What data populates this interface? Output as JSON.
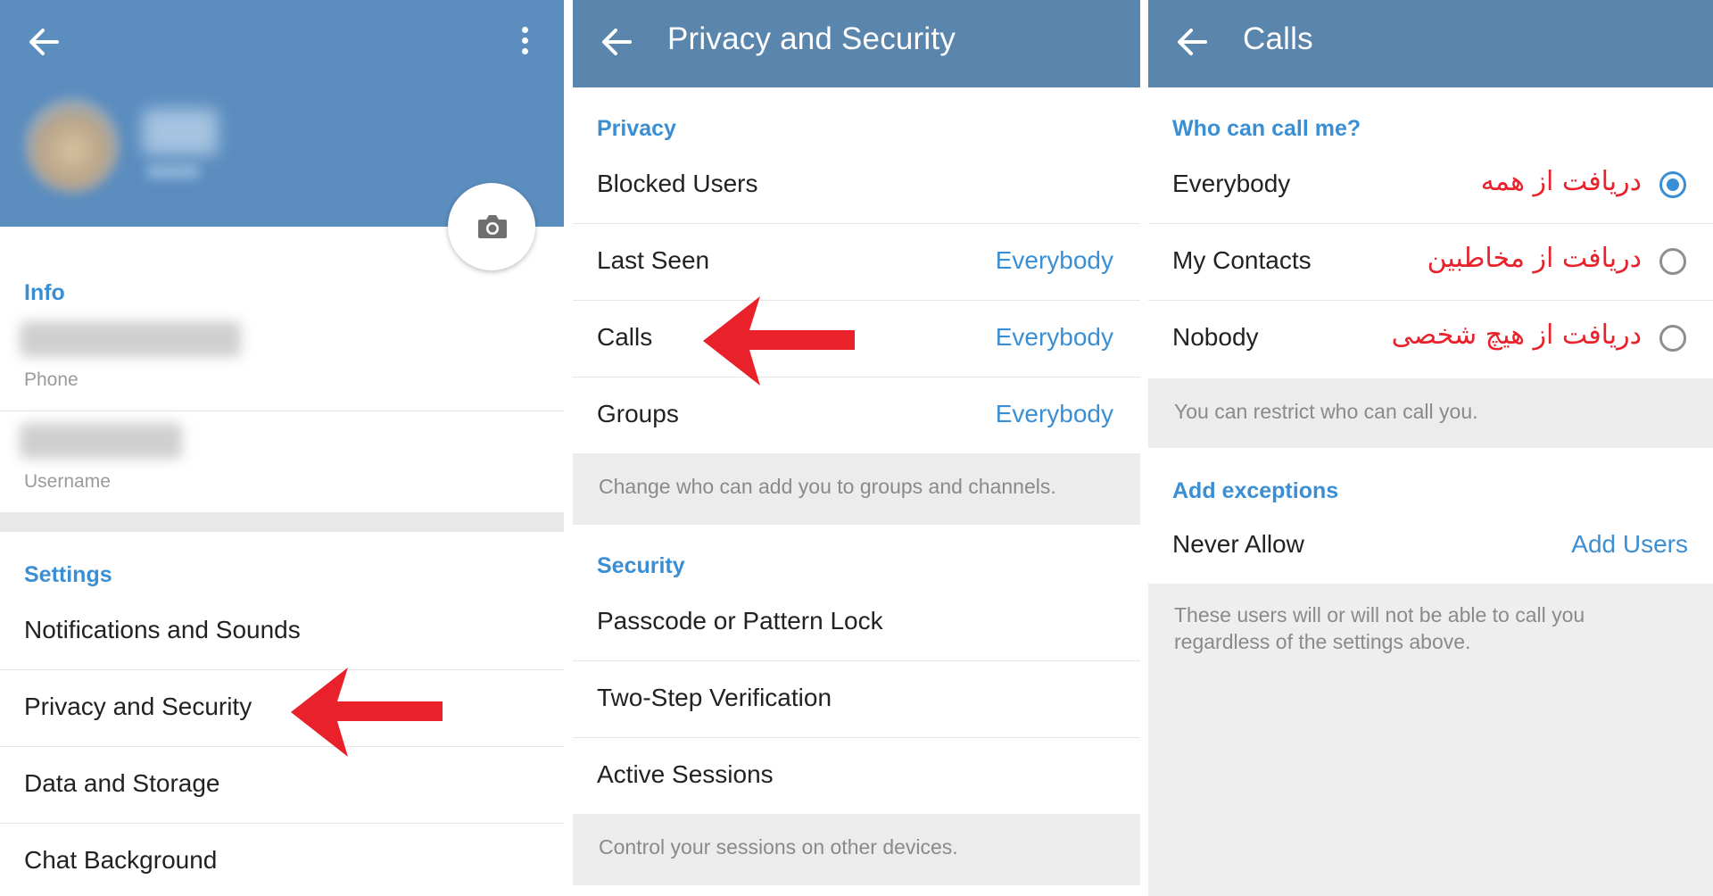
{
  "colors": {
    "header": "#5a86ad",
    "profile_header": "#5b8dbf",
    "accent": "#3a8fd4",
    "annotation_arrow": "#e8212a"
  },
  "icons": {
    "back": "arrow-left-icon",
    "menu": "more-vert-icon",
    "camera": "camera-icon",
    "annotation": "red-arrow-icon"
  },
  "settings_panel": {
    "info_header": "Info",
    "phone_label": "Phone",
    "username_label": "Username",
    "settings_header": "Settings",
    "items": [
      {
        "label": "Notifications and Sounds"
      },
      {
        "label": "Privacy and Security"
      },
      {
        "label": "Data and Storage"
      },
      {
        "label": "Chat Background"
      }
    ]
  },
  "privacy_panel": {
    "title": "Privacy and Security",
    "privacy_header": "Privacy",
    "blocked_users": "Blocked Users",
    "rows": [
      {
        "label": "Last Seen",
        "value": "Everybody"
      },
      {
        "label": "Calls",
        "value": "Everybody"
      },
      {
        "label": "Groups",
        "value": "Everybody"
      }
    ],
    "groups_note": "Change who can add you to groups and channels.",
    "security_header": "Security",
    "security_items": [
      {
        "label": "Passcode or Pattern Lock"
      },
      {
        "label": "Two-Step Verification"
      },
      {
        "label": "Active Sessions"
      }
    ],
    "sessions_note": "Control your sessions on other devices."
  },
  "calls_panel": {
    "title": "Calls",
    "who_header": "Who can call me?",
    "options": [
      {
        "label": "Everybody",
        "note": "دریافت از همه",
        "selected": true
      },
      {
        "label": "My Contacts",
        "note": "دریافت از مخاطبین",
        "selected": false
      },
      {
        "label": "Nobody",
        "note": "دریافت از هیچ شخصی",
        "selected": false
      }
    ],
    "restrict_note": "You can restrict who can call you.",
    "exceptions_header": "Add exceptions",
    "never_allow": "Never Allow",
    "add_users": "Add Users",
    "exceptions_note_line1": "These users will or will not be able to call you",
    "exceptions_note_line2": "regardless of the settings above."
  }
}
